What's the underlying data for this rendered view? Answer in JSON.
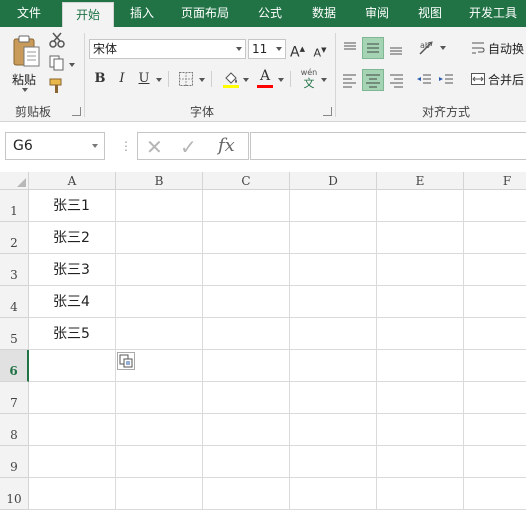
{
  "tabs": [
    "文件",
    "开始",
    "插入",
    "页面布局",
    "公式",
    "数据",
    "审阅",
    "视图",
    "开发工具"
  ],
  "ribbon": {
    "clipboard": {
      "paste_label": "粘贴",
      "group_label": "剪贴板"
    },
    "font": {
      "font_name": "宋体",
      "font_size": "11",
      "group_label": "字体",
      "bold": "B",
      "italic": "I",
      "underline": "U",
      "wen": "wén",
      "wen_sub": "文",
      "grow": "A",
      "shrink": "A",
      "font_color_glyph": "A"
    },
    "alignment": {
      "group_label": "对齐方式",
      "wrap_label": "自动换",
      "merge_label": "合并后"
    }
  },
  "formula_bar": {
    "name_box": "G6",
    "cancel_glyph": "✕",
    "enter_glyph": "✓",
    "fx_label": "fx",
    "value": ""
  },
  "columns": [
    "A",
    "B",
    "C",
    "D",
    "E",
    "F"
  ],
  "rows": [
    "1",
    "2",
    "3",
    "4",
    "5",
    "6",
    "7",
    "8",
    "9",
    "10"
  ],
  "active_row": "6",
  "cells": {
    "A1": "张三1",
    "A2": "张三2",
    "A3": "张三3",
    "A4": "张三4",
    "A5": "张三5"
  },
  "colors": {
    "accent": "#217346",
    "highlight_yellow": "#ffff00",
    "font_red": "#ff0000"
  }
}
